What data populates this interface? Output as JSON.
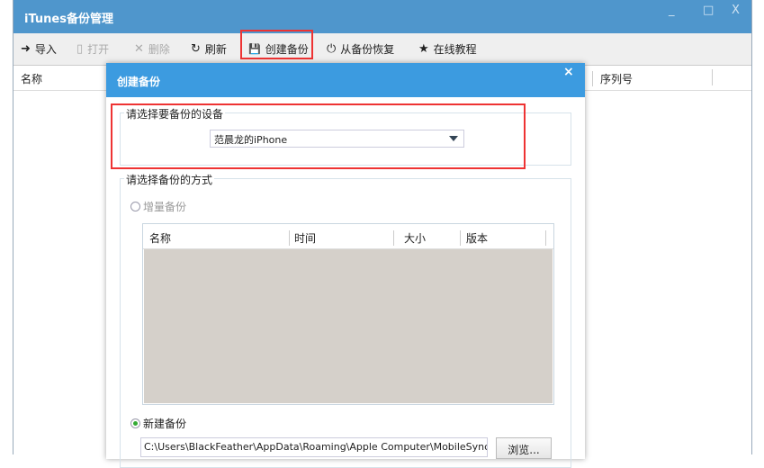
{
  "window": {
    "title": "iTunes备份管理",
    "minimize": "_",
    "maximize": "□",
    "close": "X"
  },
  "toolbar": [
    {
      "label": "导入",
      "icon": "import-icon",
      "glyph": "➜",
      "disabled": false
    },
    {
      "label": "打开",
      "icon": "open-icon",
      "glyph": "▯",
      "disabled": true
    },
    {
      "label": "删除",
      "icon": "delete-icon",
      "glyph": "✕",
      "disabled": true
    },
    {
      "label": "刷新",
      "icon": "refresh-icon",
      "glyph": "↻",
      "disabled": false
    },
    {
      "label": "创建备份",
      "icon": "save-icon",
      "glyph": "💾",
      "disabled": false
    },
    {
      "label": "从备份恢复",
      "icon": "power-icon",
      "glyph": "⏻",
      "disabled": false
    },
    {
      "label": "在线教程",
      "icon": "star-icon",
      "glyph": "★",
      "disabled": false
    }
  ],
  "columns": {
    "name": "名称",
    "serial": "序列号"
  },
  "dialog": {
    "title": "创建备份",
    "close": "×",
    "device_group": "请选择要备份的设备",
    "device_selected": "范晨龙的iPhone",
    "method_group": "请选择备份的方式",
    "incremental": "增量备份",
    "table_headers": [
      "名称",
      "时间",
      "大小",
      "版本"
    ],
    "new_backup": "新建备份",
    "path": "C:\\Users\\BlackFeather\\AppData\\Roaming\\Apple Computer\\MobileSync\\Backup",
    "browse": "浏览..."
  }
}
